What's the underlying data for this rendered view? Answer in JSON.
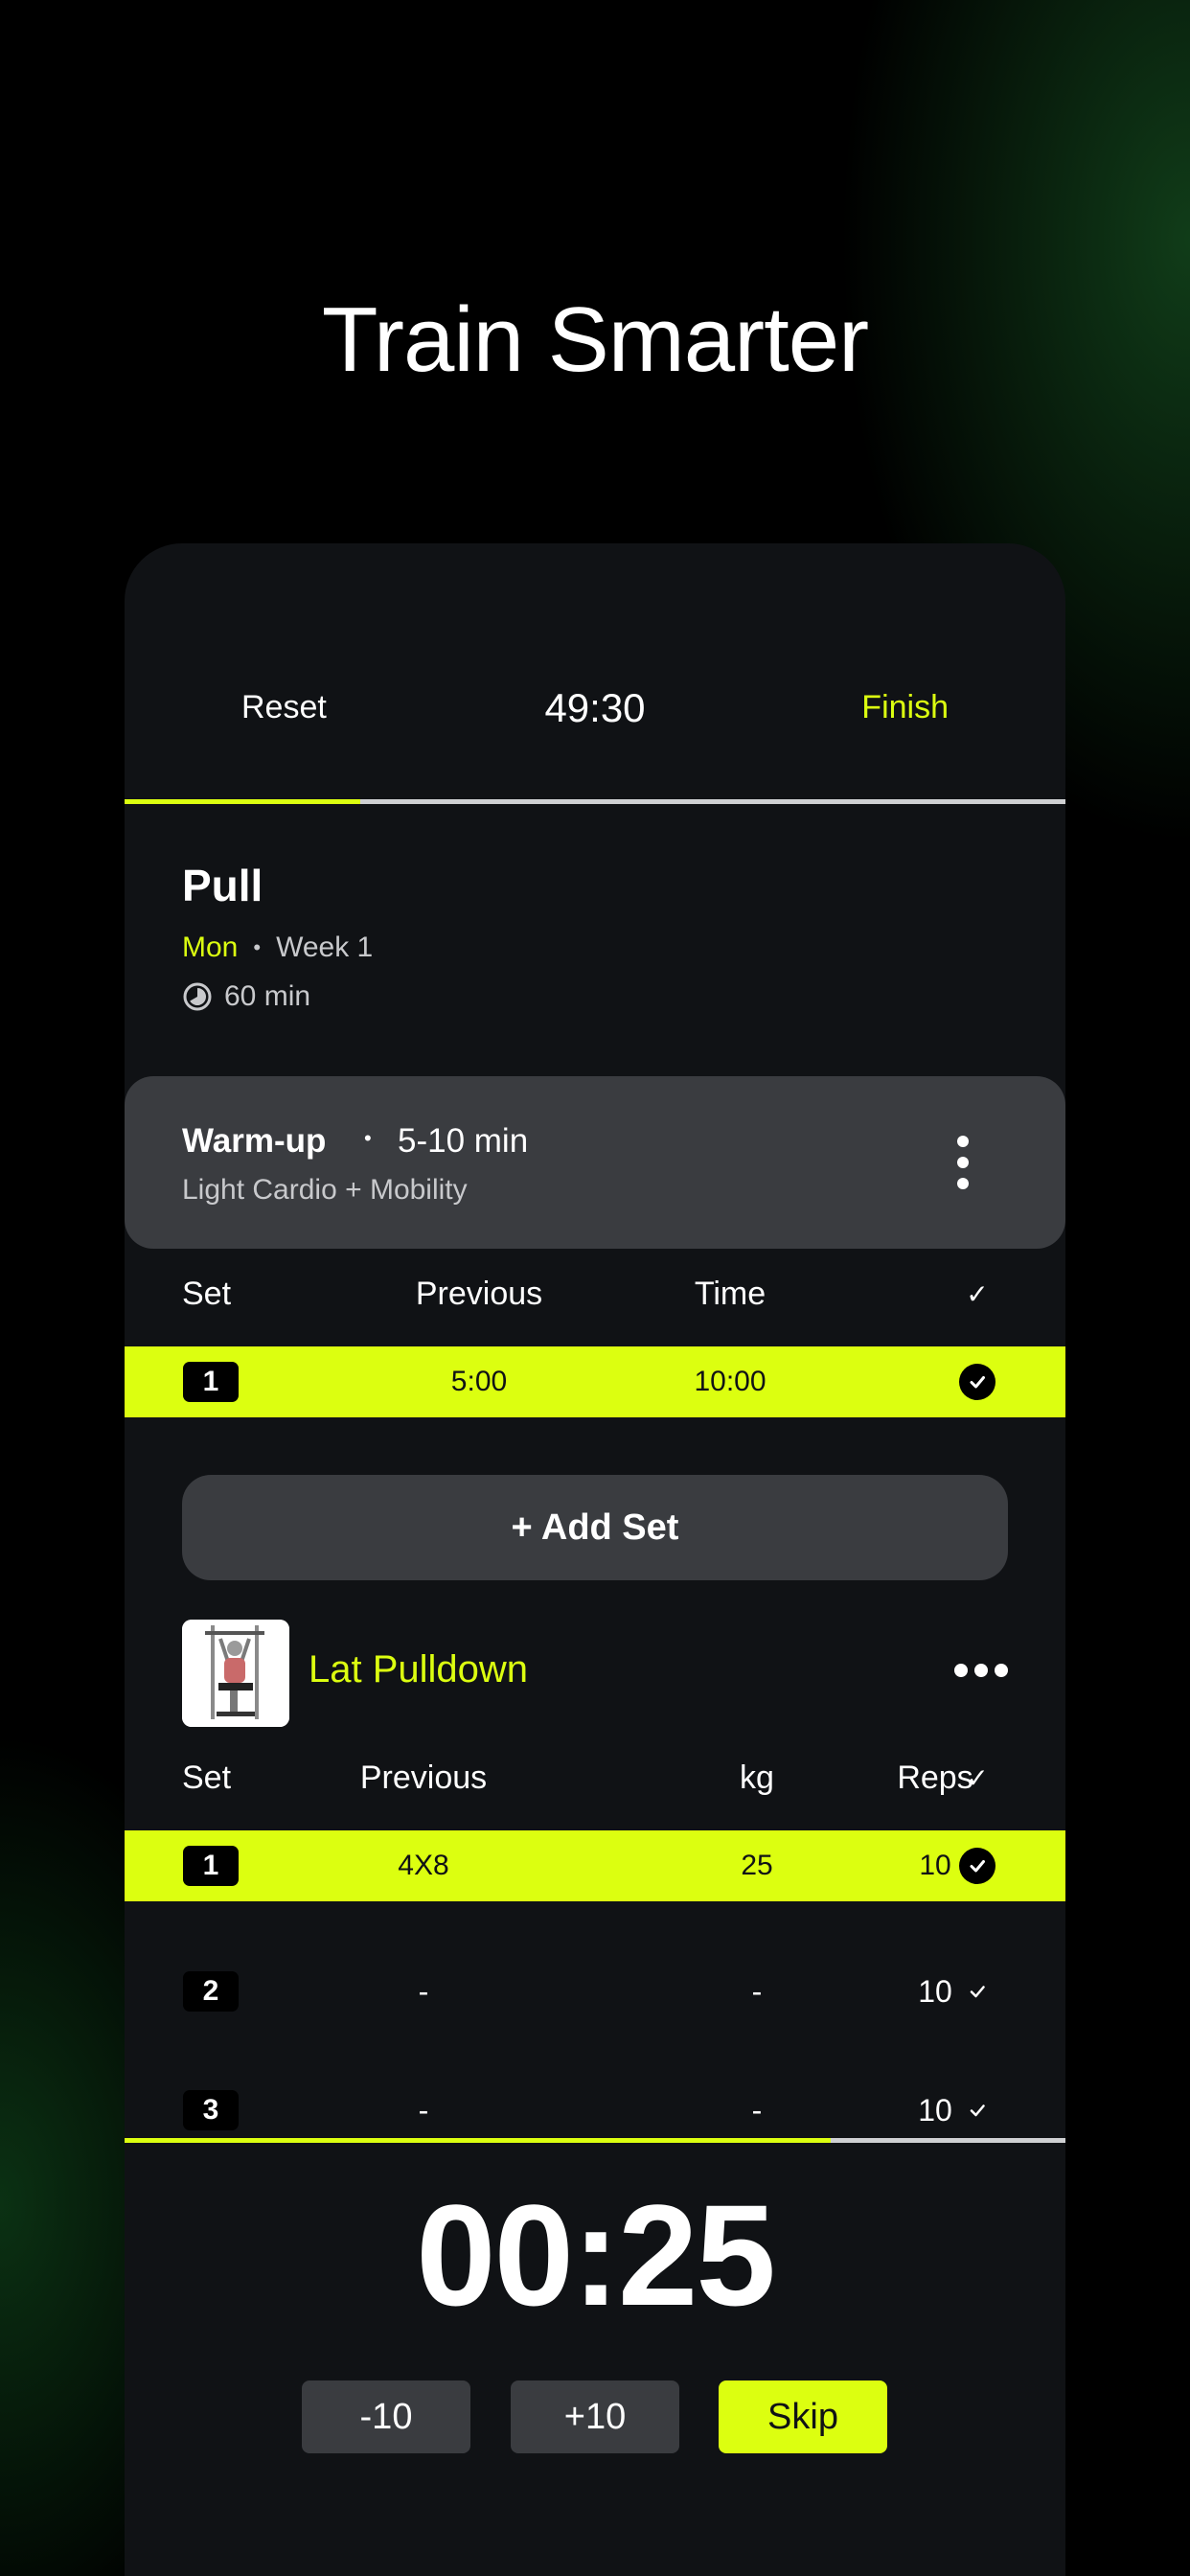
{
  "headline": "Train Smarter",
  "topbar": {
    "reset_label": "Reset",
    "timer": "49:30",
    "finish_label": "Finish",
    "progress": 0.25
  },
  "workout": {
    "title": "Pull",
    "day": "Mon",
    "week": "Week 1",
    "duration": "60 min"
  },
  "warmup": {
    "name": "Warm-up",
    "range": "5-10 min",
    "subtitle": "Light Cardio + Mobility",
    "headers": {
      "set": "Set",
      "previous": "Previous",
      "time": "Time",
      "check": "✓"
    },
    "rows": [
      {
        "set": "1",
        "previous": "5:00",
        "time": "10:00",
        "done": true
      }
    ]
  },
  "add_set_label": "+ Add Set",
  "exercise": {
    "name": "Lat Pulldown",
    "headers": {
      "set": "Set",
      "previous": "Previous",
      "kg": "kg",
      "reps": "Reps",
      "check": "✓"
    },
    "rows": [
      {
        "set": "1",
        "previous": "4X8",
        "kg": "25",
        "reps": "10",
        "done": true
      },
      {
        "set": "2",
        "previous": "-",
        "kg": "-",
        "reps": "10",
        "done": false
      },
      {
        "set": "3",
        "previous": "-",
        "kg": "-",
        "reps": "10",
        "done": false
      }
    ]
  },
  "rest": {
    "timer": "00:25",
    "progress": 0.75,
    "minus_label": "-10",
    "plus_label": "+10",
    "skip_label": "Skip"
  },
  "colors": {
    "accent": "#dcff10",
    "card": "#101215",
    "panel": "#3a3c40"
  }
}
